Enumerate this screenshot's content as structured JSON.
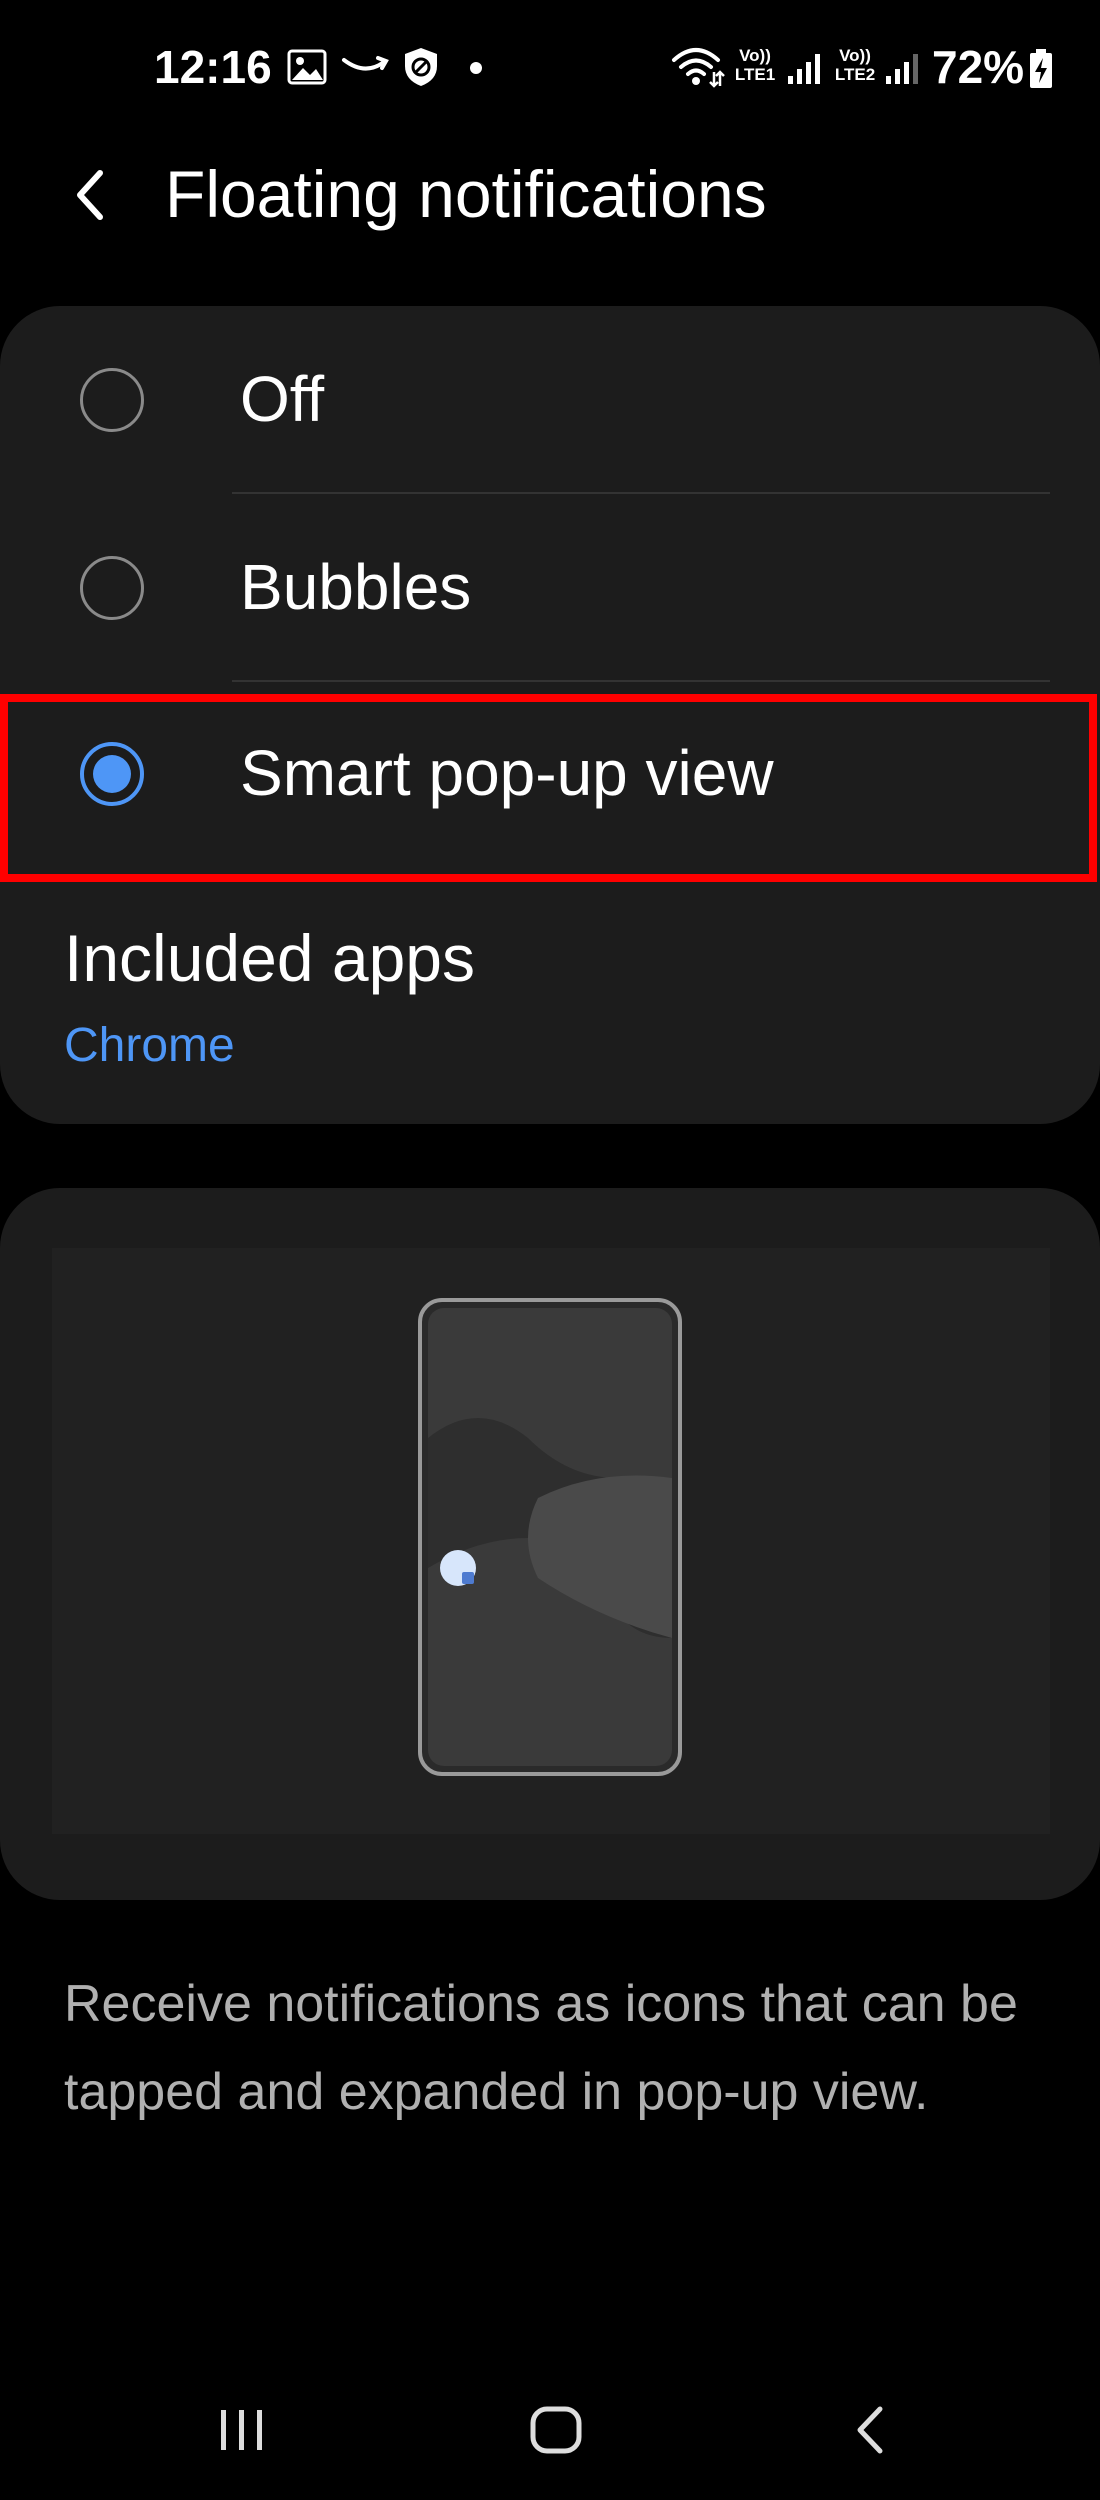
{
  "status_bar": {
    "time": "12:16",
    "sim1_label": "Vo)) LTE1",
    "sim2_label": "Vo)) LTE2",
    "battery": "72%",
    "icons": [
      "gallery-icon",
      "amazon-icon",
      "shield-icon",
      "notification-dot",
      "wifi-icon",
      "signal-icon",
      "signal-icon",
      "battery-charging-icon"
    ]
  },
  "header": {
    "title": "Floating notifications",
    "back_icon": "chevron-left-icon"
  },
  "options": [
    {
      "label": "Off",
      "selected": false
    },
    {
      "label": "Bubbles",
      "selected": false
    },
    {
      "label": "Smart pop-up view",
      "selected": true
    }
  ],
  "included_apps": {
    "title": "Included apps",
    "value": "Chrome"
  },
  "description": "Receive notifications as icons that can be tapped and expanded in pop-up view.",
  "nav_bar": {
    "icons": [
      "recents-icon",
      "home-icon",
      "back-icon"
    ]
  },
  "colors": {
    "accent": "#4e96f6",
    "highlight": "#ff0000",
    "card": "#1c1c1c",
    "background": "#000000"
  }
}
